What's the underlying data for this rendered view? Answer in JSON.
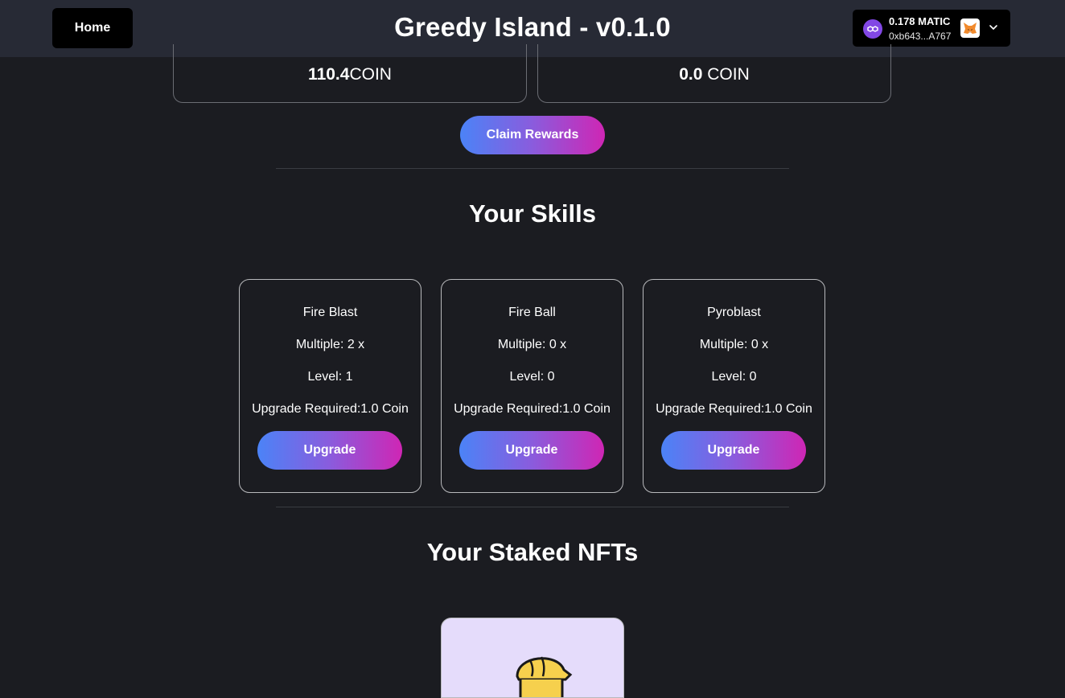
{
  "header": {
    "home_label": "Home",
    "title": "Greedy Island - v0.1.0",
    "wallet": {
      "balance": "0.178 MATIC",
      "address": "0xb643...A767",
      "token_icon": "matic-icon",
      "provider_icon": "metamask-fox-icon",
      "dropdown_icon": "chevron-down-icon"
    }
  },
  "rewards": {
    "boxes": [
      {
        "amount": "110.4",
        "unit": "COIN"
      },
      {
        "amount": "0.0",
        "unit": " COIN"
      }
    ],
    "claim_label": "Claim Rewards"
  },
  "skills": {
    "title": "Your Skills",
    "cards": [
      {
        "name": "Fire Blast",
        "multiple": "Multiple: 2 x",
        "level": "Level: 1",
        "upgrade_required": "Upgrade Required:1.0 Coin",
        "button": "Upgrade"
      },
      {
        "name": "Fire Ball",
        "multiple": "Multiple: 0 x",
        "level": "Level: 0",
        "upgrade_required": "Upgrade Required:1.0 Coin",
        "button": "Upgrade"
      },
      {
        "name": "Pyroblast",
        "multiple": "Multiple: 0 x",
        "level": "Level: 0",
        "upgrade_required": "Upgrade Required:1.0 Coin",
        "button": "Upgrade"
      }
    ]
  },
  "staked": {
    "title": "Your Staked NFTs"
  },
  "colors": {
    "background": "#1b1c21",
    "header": "#272a35",
    "gradient_start": "#4b83f7",
    "gradient_end": "#cf26b4",
    "nft_card_bg": "#e5dcfb"
  }
}
